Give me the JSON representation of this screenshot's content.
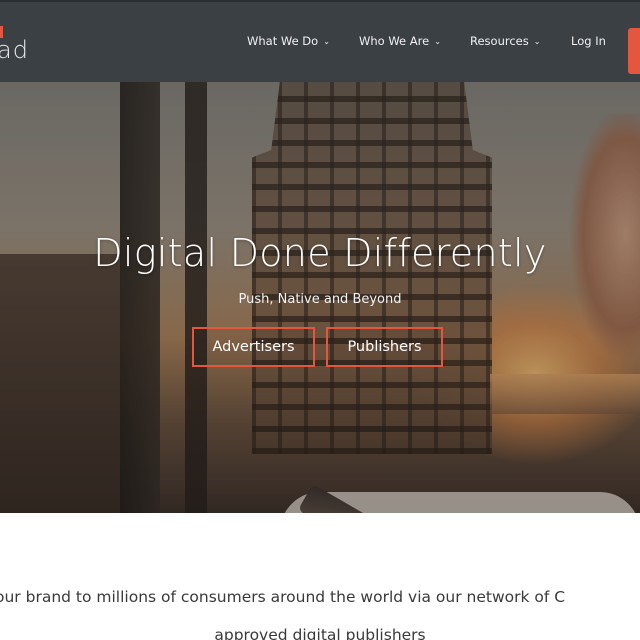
{
  "brand": {
    "logo_text": "ad",
    "accent_color": "#e2573d",
    "header_bg": "#3b4045"
  },
  "nav": {
    "items": [
      {
        "label": "What We Do",
        "has_dropdown": true
      },
      {
        "label": "Who We Are",
        "has_dropdown": true
      },
      {
        "label": "Resources",
        "has_dropdown": true
      },
      {
        "label": "Log In",
        "has_dropdown": false
      }
    ],
    "dropdown_icon": "chevron-down-icon"
  },
  "hero": {
    "title": "Digital Done Differently",
    "subtitle": "Push, Native and Beyond",
    "buttons": [
      {
        "label": "Advertisers"
      },
      {
        "label": "Publishers"
      }
    ]
  },
  "intro": {
    "line1": "our brand to millions of consumers around the world via our network of C",
    "line2": "approved digital publishers"
  }
}
